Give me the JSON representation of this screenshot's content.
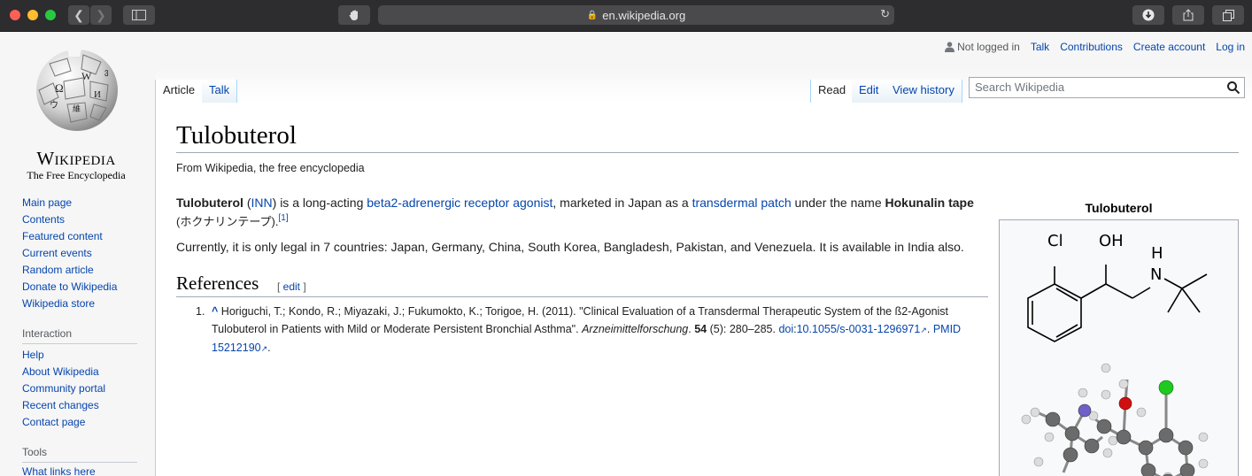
{
  "browser": {
    "url": "en.wikipedia.org",
    "traffic_lights": [
      "#fe5f57",
      "#febc2e",
      "#28c840"
    ]
  },
  "personal": {
    "not_logged_in": "Not logged in",
    "talk": "Talk",
    "contributions": "Contributions",
    "create_account": "Create account",
    "log_in": "Log in"
  },
  "logo": {
    "wordmark": "Wikipedia",
    "tagline": "The Free Encyclopedia"
  },
  "nav": {
    "main": [
      "Main page",
      "Contents",
      "Featured content",
      "Current events",
      "Random article",
      "Donate to Wikipedia",
      "Wikipedia store"
    ],
    "interaction_heading": "Interaction",
    "interaction": [
      "Help",
      "About Wikipedia",
      "Community portal",
      "Recent changes",
      "Contact page"
    ],
    "tools_heading": "Tools",
    "tools": [
      "What links here"
    ]
  },
  "tabs": {
    "article": "Article",
    "talk": "Talk",
    "read": "Read",
    "edit": "Edit",
    "history": "View history"
  },
  "search": {
    "placeholder": "Search Wikipedia"
  },
  "article": {
    "title": "Tulobuterol",
    "sitesub": "From Wikipedia, the free encyclopedia",
    "p1": {
      "bold1": "Tulobuterol",
      "t1": " (",
      "inn": "INN",
      "t2": ") is a long-acting ",
      "link1": "beta2-adrenergic receptor agonist",
      "t3": ", marketed in Japan as a ",
      "link2": "transdermal patch",
      "t4": " under the name ",
      "bold2": "Hokunalin tape",
      "t5": "(ホクナリンテープ).",
      "ref": "[1]"
    },
    "p2": "Currently, it is only legal in 7 countries: Japan, Germany, China, South Korea, Bangladesh, Pakistan, and Venezuela. It is available in India also.",
    "references_heading": "References",
    "edit_section": {
      "open": "[ ",
      "label": "edit",
      "close": " ]"
    },
    "reference1": {
      "num": "1.",
      "caret": "^",
      "authors": " Horiguchi, T.; Kondo, R.; Miyazaki, J.; Fukumokto, K.; Torigoe, H. (2011). \"Clinical Evaluation of a Transdermal Therapeutic System of the ß2-Agonist Tulobuterol in Patients with Mild or Moderate Persistent Bronchial Asthma\". ",
      "journal": "Arzneimittelforschung",
      "t1": ". ",
      "volume": "54",
      "t2": " (5): 280–285. ",
      "doi_label": "doi",
      "t3": ":",
      "doi": "10.1055/s-0031-1296971",
      "t4": ". ",
      "pmid_label": "PMID",
      "t5": " ",
      "pmid": "15212190",
      "t6": "."
    }
  },
  "infobox": {
    "title": "Tulobuterol",
    "labels": {
      "cl": "Cl",
      "oh": "OH",
      "h": "H",
      "n": "N"
    }
  }
}
